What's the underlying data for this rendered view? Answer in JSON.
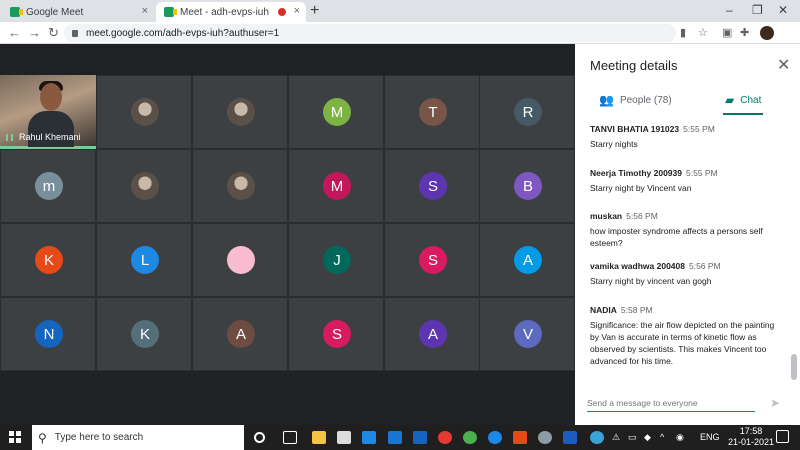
{
  "browser": {
    "tabs": [
      {
        "title": "Google Meet",
        "close": "×"
      },
      {
        "title": "Meet - adh-evps-iuh",
        "close": "×"
      }
    ],
    "new_tab": "+",
    "window_controls": [
      "–",
      "❐",
      "✕"
    ],
    "url": "meet.google.com/adh-evps-iuh?authuser=1",
    "nav": {
      "back": "←",
      "forward": "→",
      "reload": "↻"
    },
    "toolbar_icons": [
      "camera-icon",
      "star-icon",
      "extension-icon",
      "puzzle-icon",
      "profile-avatar"
    ]
  },
  "meeting": {
    "self": {
      "name": "Rahul Khemani"
    },
    "participants": [
      {
        "letter": "",
        "color": "#6d6458",
        "photo": true
      },
      {
        "letter": "",
        "color": "#c7a37a",
        "photo": true
      },
      {
        "letter": "M",
        "color": "#7cb342"
      },
      {
        "letter": "T",
        "color": "#795548"
      },
      {
        "letter": "R",
        "color": "#455a64"
      },
      {
        "letter": "m",
        "color": "#78909c"
      },
      {
        "letter": "",
        "color": "#b58a74",
        "photo": true
      },
      {
        "letter": "",
        "color": "#d9d9d9",
        "photo": true
      },
      {
        "letter": "M",
        "color": "#c2185b"
      },
      {
        "letter": "S",
        "color": "#5e35b1"
      },
      {
        "letter": "B",
        "color": "#7e57c2"
      },
      {
        "letter": "K",
        "color": "#e64a19"
      },
      {
        "letter": "L",
        "color": "#1e88e5"
      },
      {
        "letter": "",
        "color": "#f8bbd0"
      },
      {
        "letter": "J",
        "color": "#00695c"
      },
      {
        "letter": "S",
        "color": "#d81b60"
      },
      {
        "letter": "A",
        "color": "#039be5"
      },
      {
        "letter": "N",
        "color": "#1565c0"
      },
      {
        "letter": "K",
        "color": "#546e7a"
      },
      {
        "letter": "A",
        "color": "#6d4c41"
      },
      {
        "letter": "S",
        "color": "#d81b60"
      },
      {
        "letter": "A",
        "color": "#5e35b1"
      },
      {
        "letter": "V",
        "color": "#5c6bc0"
      }
    ]
  },
  "panel": {
    "title": "Meeting details",
    "close": "✕",
    "tabs": {
      "people": "People (78)",
      "chat": "Chat"
    },
    "messages": [
      {
        "sender": "TANVI BHATIA 191023",
        "time": "5:55 PM",
        "text": "Starry nights"
      },
      {
        "sender": "Neerja Timothy 200939",
        "time": "5:55 PM",
        "text": "Starry night by Vincent van"
      },
      {
        "sender": "muskan",
        "time": "5:56 PM",
        "text": "how imposter syndrome affects a persons self esteem?"
      },
      {
        "sender": "vamika wadhwa 200408",
        "time": "5:56 PM",
        "text": "Starry night by vincent van gogh"
      },
      {
        "sender": "NADIA",
        "time": "5:58 PM",
        "text": "Significance: the air flow depicted on the painting by Van is accurate in terms of kinetic flow as observed by scientists. This makes Vincent too advanced for his time."
      }
    ],
    "input_placeholder": "Send a message to everyone",
    "send_icon": "➤"
  },
  "taskbar": {
    "search_placeholder": "Type here to search",
    "language": "ENG",
    "time": "17:58",
    "date": "21-01-2021"
  }
}
